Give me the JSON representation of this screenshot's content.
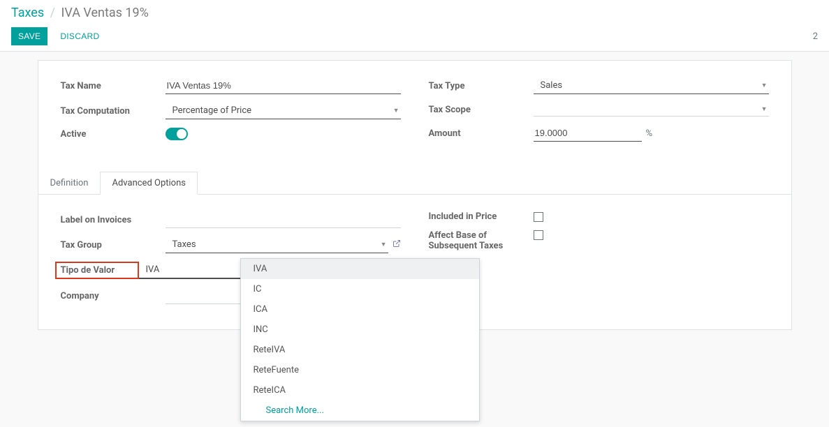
{
  "breadcrumb": {
    "root": "Taxes",
    "current": "IVA Ventas 19%"
  },
  "toolbar": {
    "save": "SAVE",
    "discard": "DISCARD",
    "count": "2"
  },
  "form": {
    "left": {
      "tax_name_label": "Tax Name",
      "tax_name_value": "IVA Ventas 19%",
      "tax_computation_label": "Tax Computation",
      "tax_computation_value": "Percentage of Price",
      "active_label": "Active"
    },
    "right": {
      "tax_type_label": "Tax Type",
      "tax_type_value": "Sales",
      "tax_scope_label": "Tax Scope",
      "tax_scope_value": "",
      "amount_label": "Amount",
      "amount_value": "19.0000",
      "amount_suffix": "%"
    }
  },
  "tabs": {
    "definition": "Definition",
    "advanced": "Advanced Options"
  },
  "advanced": {
    "left": {
      "label_invoices": "Label on Invoices",
      "label_invoices_value": "",
      "tax_group": "Tax Group",
      "tax_group_value": "Taxes",
      "tipo_valor": "Tipo de Valor",
      "tipo_valor_value": "IVA",
      "company": "Company",
      "company_value": ""
    },
    "right": {
      "included_price": "Included in Price",
      "affect_base": "Affect Base of Subsequent Taxes"
    }
  },
  "dropdown": {
    "options": [
      "IVA",
      "IC",
      "ICA",
      "INC",
      "ReteIVA",
      "ReteFuente",
      "ReteICA"
    ],
    "action": "Search More..."
  }
}
